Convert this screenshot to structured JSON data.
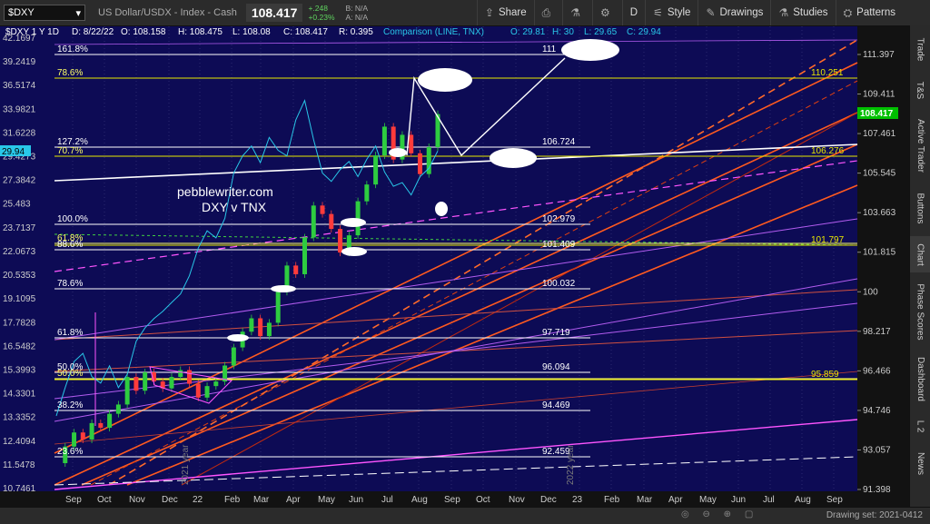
{
  "topbar": {
    "symbol": "$DXY",
    "description": "US Dollar/USDX - Index - Cash",
    "last_price": "108.417",
    "change": "+.248",
    "change_pct": "+0.23%",
    "bid": "B: N/A",
    "ask": "A: N/A",
    "buttons": [
      "Share",
      "D",
      "Style",
      "Drawings",
      "Studies",
      "Patterns"
    ]
  },
  "chart_header": {
    "title": "$DXY 1 Y 1D",
    "date": "D: 8/22/22",
    "open": "O: 108.158",
    "high": "H: 108.475",
    "low": "L: 108.08",
    "close": "C: 108.417",
    "range": "R: 0.395",
    "comparison": "Comparison (LINE, TNX)",
    "cmp_open": "O: 29.81",
    "cmp_high": "H: 30",
    "cmp_low": "L: 29.65",
    "cmp_close": "C: 29.94"
  },
  "annotation": {
    "line1": "pebblewriter.com",
    "line2": "DXY v TNX"
  },
  "sidebar_tabs": [
    "Trade",
    "T&S",
    "Active Trader",
    "Buttons",
    "Chart",
    "Phase Scores",
    "Dashboard",
    "L 2",
    "News"
  ],
  "bottom": {
    "drawing_set": "Drawing set: 2021-0412"
  },
  "chart_data": {
    "type": "line",
    "title": "$DXY 1 Y 1D",
    "x_ticks": [
      "Sep",
      "Oct",
      "Nov",
      "Dec",
      "22",
      "Feb",
      "Mar",
      "Apr",
      "May",
      "Jun",
      "Jul",
      "Aug",
      "Sep",
      "Oct",
      "Nov",
      "Dec",
      "23",
      "Feb",
      "Mar",
      "Apr",
      "May",
      "Jun",
      "Jul",
      "Aug",
      "Sep"
    ],
    "right_axis_ticks": [
      "111.397",
      "109.411",
      "107.461",
      "105.545",
      "103.663",
      "101.815",
      "100",
      "98.217",
      "96.466",
      "94.746",
      "93.057",
      "91.398"
    ],
    "left_axis_ticks": [
      "42.1697",
      "39.2419",
      "36.5174",
      "33.9821",
      "31.6228",
      "29.4273",
      "27.3842",
      "25.483",
      "23.7137",
      "22.0673",
      "20.5353",
      "19.1095",
      "17.7828",
      "16.5482",
      "15.3993",
      "14.3301",
      "13.3352",
      "12.4094",
      "11.5478",
      "10.7461"
    ],
    "current_price": "108.417",
    "tnx_current": "29.94",
    "left_ylim": [
      10.7461,
      42.1697
    ],
    "right_ylim": [
      91.398,
      111.397
    ],
    "fib_levels": [
      {
        "pct": "161.8%",
        "price": "111"
      },
      {
        "pct": "78.6%",
        "price": ""
      },
      {
        "pct": "127.2%",
        "price": "106.724"
      },
      {
        "pct": "70.7%",
        "price": ""
      },
      {
        "pct": "100.0%",
        "price": "102.979"
      },
      {
        "pct": "61.8%",
        "price": ""
      },
      {
        "pct": "88.6%",
        "price": "101.409"
      },
      {
        "pct": "78.6%",
        "price": "100.032"
      },
      {
        "pct": "61.8%",
        "price": "97.719"
      },
      {
        "pct": "50.0%",
        "price": "96.094"
      },
      {
        "pct": "50.0%",
        "price": ""
      },
      {
        "pct": "38.2%",
        "price": "94.469"
      },
      {
        "pct": "23.6%",
        "price": "92.459"
      }
    ],
    "yellow_levels": [
      "110.251",
      "106.276",
      "101.797",
      "95.859"
    ],
    "vertical_labels": [
      "2021 year",
      "2022 year"
    ],
    "series": [
      {
        "name": "$DXY",
        "values": [
          92.5,
          93.2,
          93.8,
          93.5,
          94.2,
          94.0,
          94.6,
          95.0,
          96.2,
          95.6,
          96.4,
          96.0,
          95.7,
          96.2,
          96.5,
          95.9,
          95.3,
          95.8,
          96.0,
          96.7,
          97.5,
          98.2,
          98.8,
          98.0,
          98.6,
          100.0,
          101.2,
          100.8,
          102.5,
          104.0,
          103.6,
          102.9,
          101.8,
          102.6,
          104.2,
          105.0,
          106.4,
          107.8,
          106.2,
          107.4,
          106.5,
          105.5,
          106.8,
          108.417
        ]
      },
      {
        "name": "TNX",
        "values": [
          13.4,
          14.6,
          15.8,
          16.2,
          15.1,
          14.8,
          15.6,
          14.6,
          15.2,
          16.8,
          17.5,
          18.0,
          18.4,
          18.9,
          19.4,
          20.5,
          22.3,
          23.5,
          23.0,
          24.4,
          28.0,
          29.5,
          30.4,
          28.9,
          31.2,
          30.0,
          29.5,
          32.9,
          34.9,
          31.0,
          28.0,
          27.3,
          28.3,
          29.0,
          27.7,
          29.2,
          30.4,
          28.1,
          26.9,
          27.2,
          26.2,
          27.7,
          28.4,
          29.94
        ]
      }
    ]
  }
}
